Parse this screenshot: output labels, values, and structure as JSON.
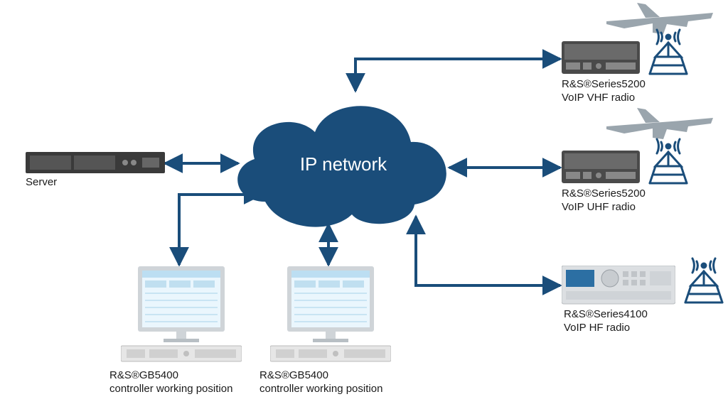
{
  "cloud": {
    "label": "IP network"
  },
  "server": {
    "label": "Server"
  },
  "controller1": {
    "line1": "R&S®GB5400",
    "line2": "controller working position"
  },
  "controller2": {
    "line1": "R&S®GB5400",
    "line2": "controller working position"
  },
  "radio_vhf": {
    "line1": "R&S®Series5200",
    "line2": "VoIP VHF radio"
  },
  "radio_uhf": {
    "line1": "R&S®Series5200",
    "line2": "VoIP UHF radio"
  },
  "radio_hf": {
    "line1": "R&S®Series4100",
    "line2": "VoIP HF radio"
  },
  "colors": {
    "primary": "#1a4d7a",
    "text": "#1a1a1a",
    "screen": "#dff0fb",
    "device": "#e6e6e6",
    "device_dark": "#3a3a3a"
  }
}
